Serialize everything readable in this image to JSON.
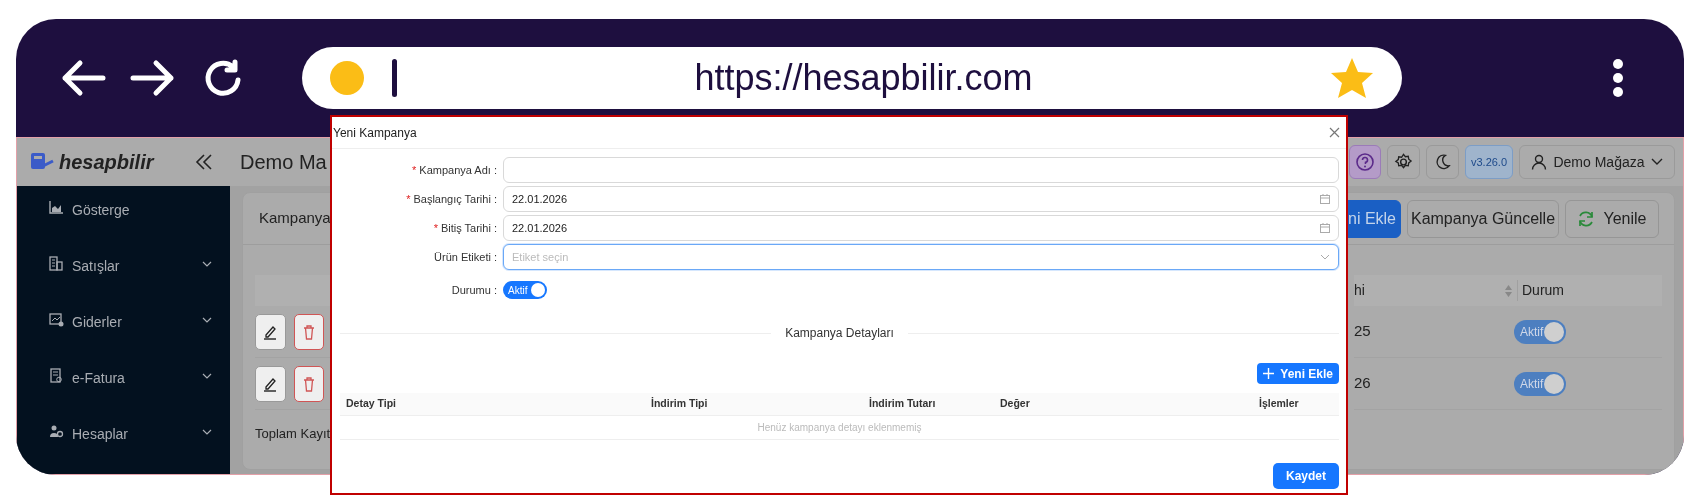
{
  "browser": {
    "url": "https://hesapbilir.com"
  },
  "app": {
    "logo": "hesapbilir",
    "store_title": "Demo Ma",
    "version": "v3.26.0",
    "user": "Demo Mağaza",
    "sidebar": [
      {
        "label": "Gösterge",
        "has_submenu": false
      },
      {
        "label": "Satışlar",
        "has_submenu": true
      },
      {
        "label": "Giderler",
        "has_submenu": true
      },
      {
        "label": "e-Fatura",
        "has_submenu": true
      },
      {
        "label": "Hesaplar",
        "has_submenu": true
      }
    ],
    "page_title": "Kampanya",
    "buttons": [
      {
        "label": "ni Ekle",
        "kind": "primary"
      },
      {
        "label": "Kampanya Güncelle",
        "kind": "default"
      },
      {
        "label": "Yenile",
        "kind": "refresh"
      }
    ],
    "table": {
      "columns": [
        "hi",
        "Durum"
      ],
      "rows": [
        {
          "column_1": "25",
          "status": "Aktif",
          "on": true
        },
        {
          "column_1": "26",
          "status": "Aktif",
          "on": true
        }
      ]
    },
    "footer": "Toplam Kayıt"
  },
  "modal": {
    "title": "Yeni Kampanya",
    "fields": [
      {
        "kind": "text",
        "label": "Kampanya Adı :",
        "required_mark": "*"
      },
      {
        "kind": "date",
        "label": "Başlangıç Tarihi :",
        "required_mark": "*",
        "value": "22.01.2026"
      },
      {
        "kind": "date",
        "label": "Bitiş Tarihi :",
        "required_mark": "*",
        "value": "22.01.2026"
      },
      {
        "kind": "select",
        "label": "Ürün Etiketi :",
        "placeholder": "Etiket seçin",
        "focused": true
      },
      {
        "kind": "switch",
        "label": "Durumu :",
        "text": "Aktif",
        "on": true
      }
    ],
    "section_title": "Kampanya Detayları",
    "add_button": "Yeni Ekle",
    "detail_columns": [
      "Detay Tipi",
      "İndirim Tipi",
      "İndirim Tutarı",
      "Değer",
      "İşlemler"
    ],
    "empty_text": "Henüz kampanya detayı eklenmemiş",
    "save_button": "Kaydet"
  }
}
